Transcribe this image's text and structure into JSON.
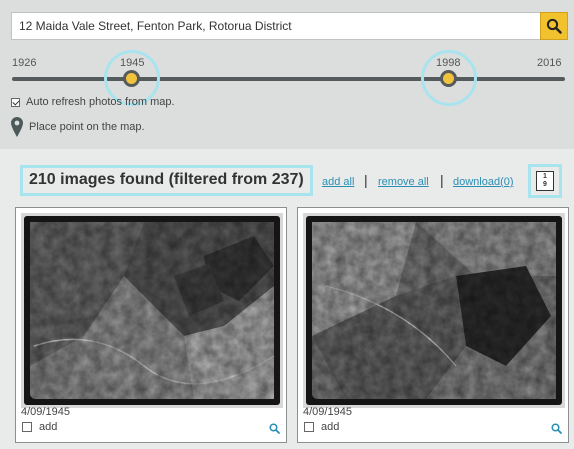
{
  "search": {
    "value": "12 Maida Vale Street, Fenton Park, Rotorua District"
  },
  "timeline": {
    "start_year": "1926",
    "end_year": "2016",
    "selected_from": "1945",
    "selected_to": "1998"
  },
  "options": {
    "auto_refresh_label": "Auto refresh photos from map.",
    "auto_refresh_checked": true,
    "place_point_label": "Place point on the map."
  },
  "results": {
    "count_text": "210 images found (filtered from 237)",
    "add_all": "add all",
    "remove_all": "remove all",
    "download": "download(0)",
    "separator": "|",
    "sort_icon_top": "1",
    "sort_icon_bottom": "9"
  },
  "cards": [
    {
      "date": "4/09/1945",
      "add_label": "add"
    },
    {
      "date": "4/09/1945",
      "add_label": "add"
    }
  ],
  "colors": {
    "accent_yellow": "#f1c23b",
    "highlight_cyan": "#a8e4ee",
    "link_blue": "#2b8fb3",
    "track_gray": "#555b5d"
  },
  "icons": {
    "search": "search-icon",
    "pin": "map-pin-icon",
    "sort": "sort-numeric-icon",
    "zoom": "magnify-icon"
  }
}
